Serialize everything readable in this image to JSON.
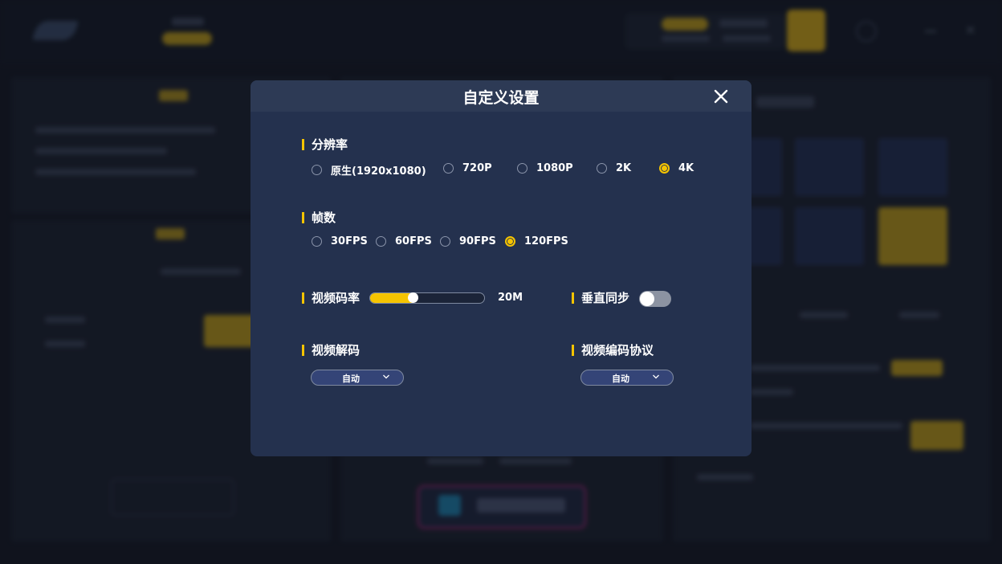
{
  "modal": {
    "title": "自定义设置",
    "resolution": {
      "label": "分辨率",
      "options": [
        "原生(1920x1080)",
        "720P",
        "1080P",
        "2K",
        "4K"
      ],
      "selected": "4K"
    },
    "fps": {
      "label": "帧数",
      "options": [
        "30FPS",
        "60FPS",
        "90FPS",
        "120FPS"
      ],
      "selected": "120FPS"
    },
    "bitrate": {
      "label": "视频码率",
      "value_text": "20M",
      "fill_fraction": 0.37
    },
    "vsync": {
      "label": "垂直同步",
      "enabled": false
    },
    "decode": {
      "label": "视频解码",
      "selected": "自动"
    },
    "encode_protocol": {
      "label": "视频编码协议",
      "selected": "自动"
    }
  },
  "icons": {
    "close": "close-icon",
    "dropdown": "chevron-down-icon"
  },
  "colors": {
    "accent": "#f5c400",
    "modal_bg": "#24314e",
    "header_bg": "#2d3a55",
    "select_bg": "#344477"
  }
}
